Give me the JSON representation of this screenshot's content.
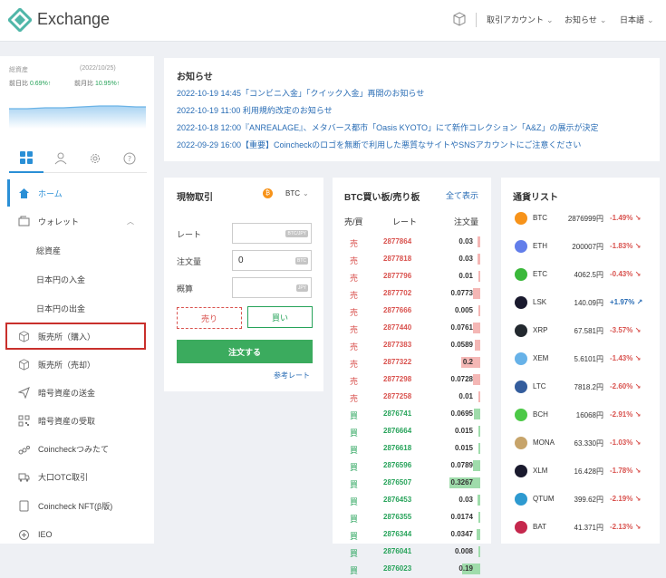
{
  "app": {
    "title": "Exchange"
  },
  "header": {
    "menus": [
      "取引アカウント",
      "お知らせ",
      "日本語"
    ]
  },
  "balance": {
    "label": "総資産",
    "date": "(2022/10/25)",
    "prev_day_label": "前日比",
    "prev_day_value": "0.69%↑",
    "prev_month_label": "前月比",
    "prev_month_value": "10.95%↑"
  },
  "icon_tabs": [
    "grid-icon",
    "user-icon",
    "gear-icon",
    "help-icon"
  ],
  "nav": {
    "home": "ホーム",
    "wallet": "ウォレット",
    "wallet_sub": [
      "総資産",
      "日本円の入金",
      "日本円の出金"
    ],
    "items": [
      "販売所（購入）",
      "販売所（売却）",
      "暗号資産の送金",
      "暗号資産の受取",
      "Coincheckつみたて",
      "大口OTC取引",
      "Coincheck NFT(β版)",
      "IEO"
    ]
  },
  "news": {
    "title": "お知らせ",
    "items": [
      "2022-10-19 14:45「コンビニ入金」「クイック入金」再開のお知らせ",
      "2022-10-19 11:00 利用規約改定のお知らせ",
      "2022-10-18 12:00『ANREALAGE』、メタバース都市「Oasis KYOTO」にて新作コレクション「A&Z」の展示が決定",
      "2022-09-29 16:00【重要】Coincheckのロゴを無断で利用した悪質なサイトやSNSアカウントにご注意ください"
    ]
  },
  "spot": {
    "title": "現物取引",
    "pair": "BTC",
    "rate_label": "レート",
    "rate_tag": "BTC/JPY",
    "amount_label": "注文量",
    "amount_value": "0",
    "amount_tag": "BTC",
    "estimate_label": "概算",
    "estimate_tag": "JPY",
    "sell_label": "売り",
    "buy_label": "買い",
    "order_label": "注文する",
    "ref_link": "参考レート"
  },
  "orderbook": {
    "title": "BTC買い板/売り板",
    "show_all": "全て表示",
    "col_side": "売/買",
    "col_rate": "レート",
    "col_qty": "注文量",
    "sell_label": "売",
    "buy_label": "買",
    "rows": [
      {
        "side": "sell",
        "rate": "2877864",
        "qty": "0.03",
        "depth": 0.03
      },
      {
        "side": "sell",
        "rate": "2877818",
        "qty": "0.03",
        "depth": 0.03
      },
      {
        "side": "sell",
        "rate": "2877796",
        "qty": "0.01",
        "depth": 0.01
      },
      {
        "side": "sell",
        "rate": "2877702",
        "qty": "0.0773",
        "depth": 0.0773
      },
      {
        "side": "sell",
        "rate": "2877666",
        "qty": "0.005",
        "depth": 0.005
      },
      {
        "side": "sell",
        "rate": "2877440",
        "qty": "0.0761",
        "depth": 0.0761
      },
      {
        "side": "sell",
        "rate": "2877383",
        "qty": "0.0589",
        "depth": 0.0589
      },
      {
        "side": "sell",
        "rate": "2877322",
        "qty": "0.2",
        "depth": 0.2
      },
      {
        "side": "sell",
        "rate": "2877298",
        "qty": "0.0728",
        "depth": 0.0728
      },
      {
        "side": "sell",
        "rate": "2877258",
        "qty": "0.01",
        "depth": 0.01
      },
      {
        "side": "buy",
        "rate": "2876741",
        "qty": "0.0695",
        "depth": 0.0695
      },
      {
        "side": "buy",
        "rate": "2876664",
        "qty": "0.015",
        "depth": 0.015
      },
      {
        "side": "buy",
        "rate": "2876618",
        "qty": "0.015",
        "depth": 0.015
      },
      {
        "side": "buy",
        "rate": "2876596",
        "qty": "0.0789",
        "depth": 0.0789
      },
      {
        "side": "buy",
        "rate": "2876507",
        "qty": "0.3267",
        "depth": 0.3267
      },
      {
        "side": "buy",
        "rate": "2876453",
        "qty": "0.03",
        "depth": 0.03
      },
      {
        "side": "buy",
        "rate": "2876355",
        "qty": "0.0174",
        "depth": 0.0174
      },
      {
        "side": "buy",
        "rate": "2876344",
        "qty": "0.0347",
        "depth": 0.0347
      },
      {
        "side": "buy",
        "rate": "2876041",
        "qty": "0.008",
        "depth": 0.008
      },
      {
        "side": "buy",
        "rate": "2876023",
        "qty": "0.19",
        "depth": 0.19
      }
    ]
  },
  "coins": {
    "title": "通貨リスト",
    "items": [
      {
        "sym": "BTC",
        "price": "2876999円",
        "chg": "-1.49%",
        "dir": "neg",
        "color": "#f7931a",
        "icon": "bitcoin-icon"
      },
      {
        "sym": "ETH",
        "price": "200007円",
        "chg": "-1.83%",
        "dir": "neg",
        "color": "#627eea",
        "icon": "ethereum-icon"
      },
      {
        "sym": "ETC",
        "price": "4062.5円",
        "chg": "-0.43%",
        "dir": "neg",
        "color": "#3ab83a",
        "icon": "ethereum-classic-icon"
      },
      {
        "sym": "LSK",
        "price": "140.09円",
        "chg": "+1.97%",
        "dir": "pos",
        "color": "#1a1a2e",
        "icon": "lisk-icon"
      },
      {
        "sym": "XRP",
        "price": "67.581円",
        "chg": "-3.57%",
        "dir": "neg",
        "color": "#23292f",
        "icon": "xrp-icon"
      },
      {
        "sym": "XEM",
        "price": "5.6101円",
        "chg": "-1.43%",
        "dir": "neg",
        "color": "#67b2e8",
        "icon": "nem-icon"
      },
      {
        "sym": "LTC",
        "price": "7818.2円",
        "chg": "-2.60%",
        "dir": "neg",
        "color": "#345d9d",
        "icon": "litecoin-icon"
      },
      {
        "sym": "BCH",
        "price": "16068円",
        "chg": "-2.91%",
        "dir": "neg",
        "color": "#4cc947",
        "icon": "bitcoin-cash-icon"
      },
      {
        "sym": "MONA",
        "price": "63.330円",
        "chg": "-1.03%",
        "dir": "neg",
        "color": "#c7a46a",
        "icon": "monacoin-icon"
      },
      {
        "sym": "XLM",
        "price": "16.428円",
        "chg": "-1.78%",
        "dir": "neg",
        "color": "#1a1a2e",
        "icon": "stellar-icon"
      },
      {
        "sym": "QTUM",
        "price": "399.62円",
        "chg": "-2.19%",
        "dir": "neg",
        "color": "#2e9ad0",
        "icon": "qtum-icon"
      },
      {
        "sym": "BAT",
        "price": "41.371円",
        "chg": "-2.13%",
        "dir": "neg",
        "color": "#c5284d",
        "icon": "bat-icon"
      }
    ]
  },
  "colors": {
    "accent": "#2a8fd6",
    "buy": "#27a35a",
    "sell": "#d9534f",
    "highlight": "#c9302c"
  }
}
